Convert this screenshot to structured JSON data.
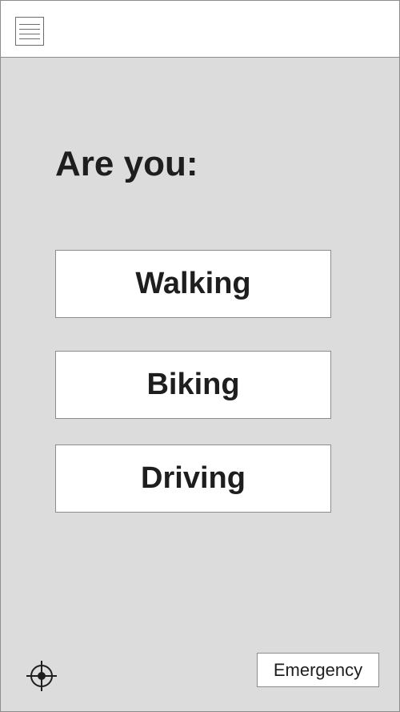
{
  "header": {
    "menu_icon": "hamburger-menu-icon"
  },
  "main": {
    "heading": "Are you:",
    "options": [
      {
        "label": "Walking"
      },
      {
        "label": "Biking"
      },
      {
        "label": "Driving"
      }
    ]
  },
  "footer": {
    "locate_icon": "crosshair-locate-icon",
    "emergency_label": "Emergency"
  },
  "colors": {
    "background": "#dcdcdc",
    "header_background": "#ffffff",
    "button_background": "#ffffff",
    "border": "#8c8c8c",
    "text": "#1e1e1e"
  }
}
